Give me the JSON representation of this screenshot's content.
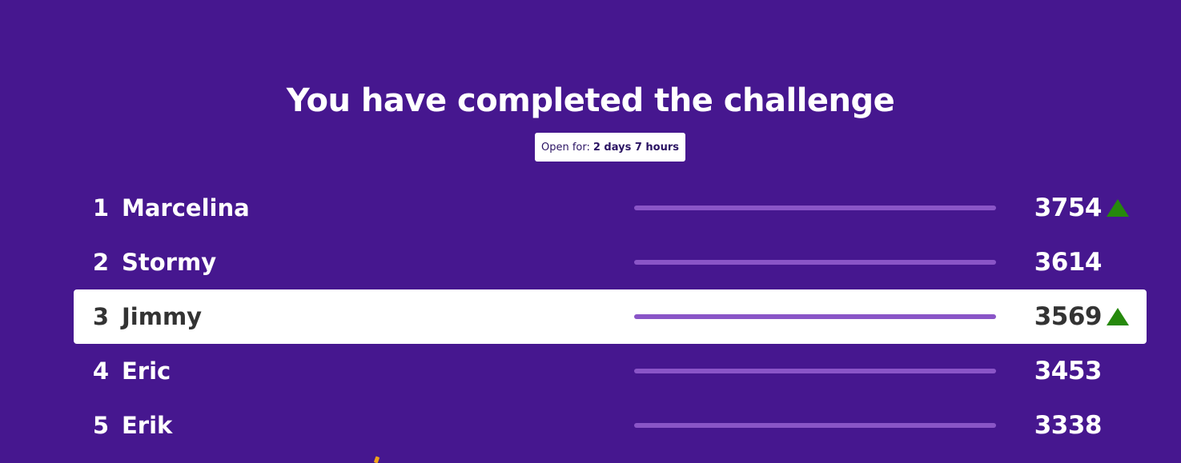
{
  "header": {
    "title": "You have completed the challenge",
    "open_for_label": "Open for:",
    "open_for_value": "2 days 7 hours"
  },
  "colors": {
    "background": "#46178f",
    "bar": "#8a55c7",
    "trend_up": "#26890c",
    "highlight_row": "#ffffff"
  },
  "leaderboard": [
    {
      "rank": "1",
      "name": "Marcelina",
      "score": "3754",
      "trend": "up-arrow-icon"
    },
    {
      "rank": "2",
      "name": "Stormy",
      "score": "3614",
      "trend": "none"
    },
    {
      "rank": "3",
      "name": "Jimmy",
      "score": "3569",
      "trend": "up-arrow-icon",
      "current_player": true
    },
    {
      "rank": "4",
      "name": "Eric",
      "score": "3453",
      "trend": "none"
    },
    {
      "rank": "5",
      "name": "Erik",
      "score": "3338",
      "trend": "none"
    }
  ]
}
